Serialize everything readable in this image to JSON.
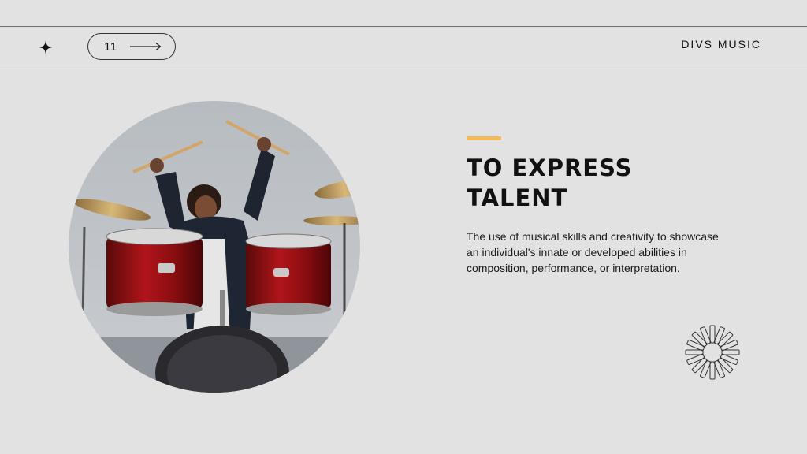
{
  "header": {
    "page_number": "11",
    "brand": "DIVS MUSIC",
    "star_icon": "four-point-star-icon",
    "arrow_icon": "long-arrow-right-icon"
  },
  "main": {
    "photo_alt": "Child drummer with raised drumsticks behind a red drum kit",
    "heading": "TO EXPRESS TALENT",
    "description": "The use of musical skills and creativity to showcase an individual's innate or developed abilities in composition, performance, or interpretation.",
    "decor_icon": "radial-burst-icon"
  },
  "colors": {
    "background": "#e2e2e2",
    "accent": "#f4b95a",
    "text": "#111111"
  }
}
